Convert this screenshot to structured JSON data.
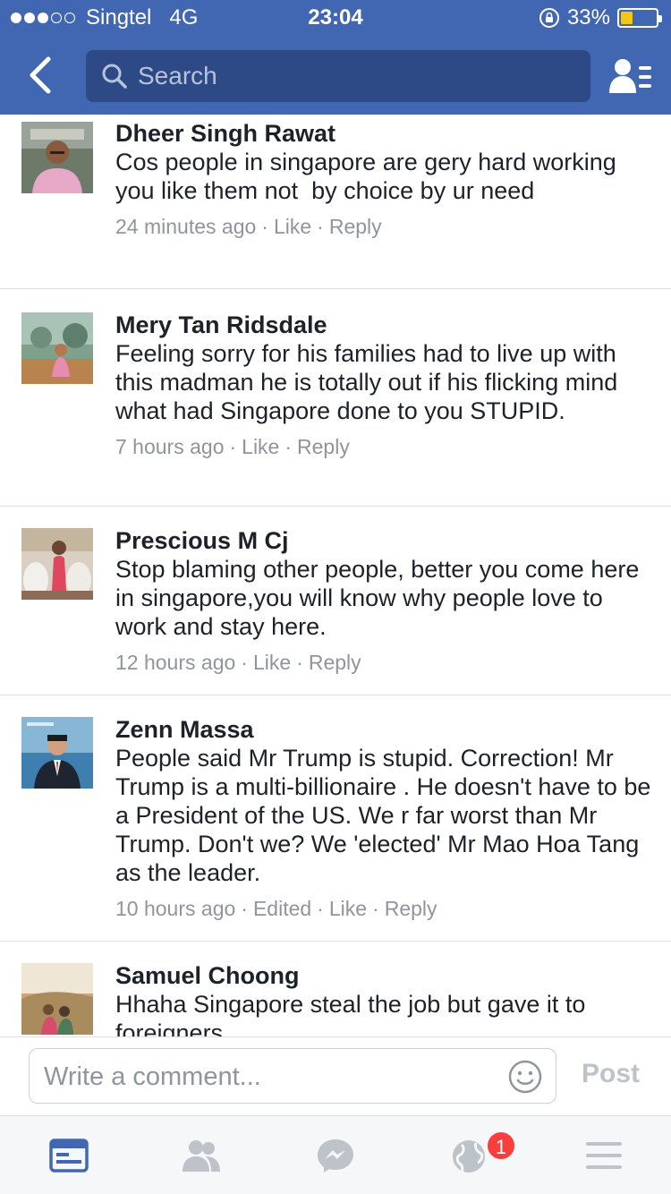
{
  "status_bar": {
    "carrier": "Singtel",
    "network": "4G",
    "time": "23:04",
    "battery_percent": "33%",
    "battery_level": 0.33
  },
  "nav": {
    "search_placeholder": "Search",
    "icons": [
      "back-chevron-icon",
      "search-icon",
      "friends-list-icon"
    ]
  },
  "comments": [
    {
      "name": "Dheer Singh Rawat",
      "text": "Cos people in singapore are gery hard working you like them not  by choice by ur need",
      "time": "24 minutes ago",
      "like": "Like",
      "reply": "Reply"
    },
    {
      "name": "Mery Tan Ridsdale",
      "text": "Feeling sorry for his families had to live up with this madman he is totally out if his flicking mind what had Singapore done to you STUPID.",
      "time": "7 hours ago",
      "like": "Like",
      "reply": "Reply"
    },
    {
      "name": "Prescious M Cj",
      "text": "Stop blaming other people, better you come here in singapore,you will know why people love to work and stay here.",
      "time": "12 hours ago",
      "like": "Like",
      "reply": "Reply"
    },
    {
      "name": "Zenn Massa",
      "text": "People said Mr Trump is stupid. Correction! Mr Trump is a multi-billionaire . He doesn't have to be a President of the US. We r far worst than Mr Trump. Don't we? We 'elected' Mr Mao Hoa Tang as the leader.",
      "time": "10 hours ago",
      "edited": "Edited",
      "like": "Like",
      "reply": "Reply"
    },
    {
      "name": "Samuel Choong",
      "text": "Hhaha Singapore steal the job but gave it to foreigners"
    }
  ],
  "composer": {
    "placeholder": "Write a comment...",
    "post_label": "Post"
  },
  "tabbar": {
    "tabs": [
      "news-feed-icon",
      "friend-requests-icon",
      "messenger-icon",
      "notifications-globe-icon",
      "menu-icon"
    ],
    "notification_count": "1"
  },
  "colors": {
    "brand_blue": "#4267b2",
    "active_tab": "#4267b2",
    "inactive_tab": "#bec2c9",
    "badge_red": "#fa3e3e",
    "meta_gray": "#90949c"
  }
}
